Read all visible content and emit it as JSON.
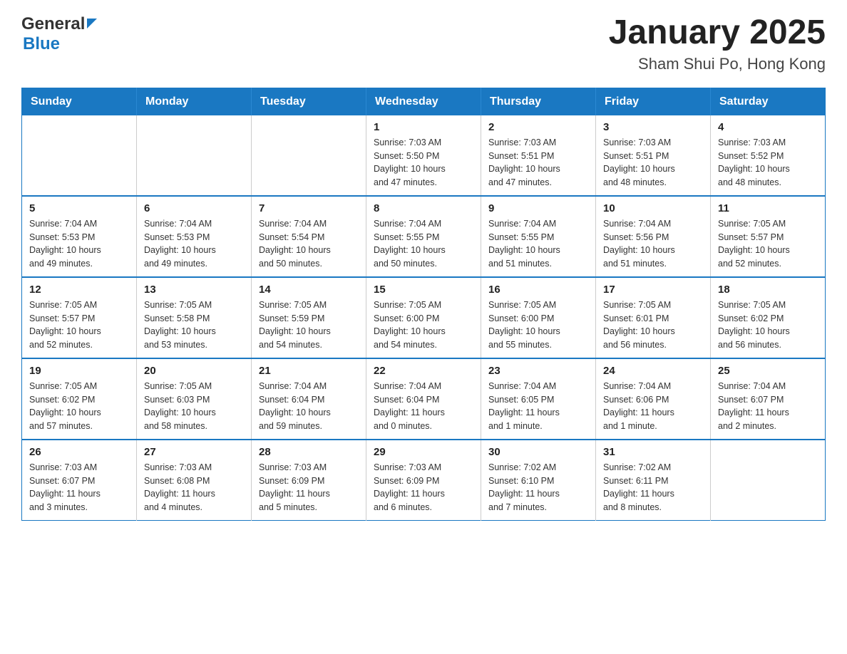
{
  "header": {
    "logo_general": "General",
    "logo_blue": "Blue",
    "title": "January 2025",
    "subtitle": "Sham Shui Po, Hong Kong"
  },
  "days_of_week": [
    "Sunday",
    "Monday",
    "Tuesday",
    "Wednesday",
    "Thursday",
    "Friday",
    "Saturday"
  ],
  "weeks": [
    [
      {
        "day": "",
        "info": ""
      },
      {
        "day": "",
        "info": ""
      },
      {
        "day": "",
        "info": ""
      },
      {
        "day": "1",
        "info": "Sunrise: 7:03 AM\nSunset: 5:50 PM\nDaylight: 10 hours\nand 47 minutes."
      },
      {
        "day": "2",
        "info": "Sunrise: 7:03 AM\nSunset: 5:51 PM\nDaylight: 10 hours\nand 47 minutes."
      },
      {
        "day": "3",
        "info": "Sunrise: 7:03 AM\nSunset: 5:51 PM\nDaylight: 10 hours\nand 48 minutes."
      },
      {
        "day": "4",
        "info": "Sunrise: 7:03 AM\nSunset: 5:52 PM\nDaylight: 10 hours\nand 48 minutes."
      }
    ],
    [
      {
        "day": "5",
        "info": "Sunrise: 7:04 AM\nSunset: 5:53 PM\nDaylight: 10 hours\nand 49 minutes."
      },
      {
        "day": "6",
        "info": "Sunrise: 7:04 AM\nSunset: 5:53 PM\nDaylight: 10 hours\nand 49 minutes."
      },
      {
        "day": "7",
        "info": "Sunrise: 7:04 AM\nSunset: 5:54 PM\nDaylight: 10 hours\nand 50 minutes."
      },
      {
        "day": "8",
        "info": "Sunrise: 7:04 AM\nSunset: 5:55 PM\nDaylight: 10 hours\nand 50 minutes."
      },
      {
        "day": "9",
        "info": "Sunrise: 7:04 AM\nSunset: 5:55 PM\nDaylight: 10 hours\nand 51 minutes."
      },
      {
        "day": "10",
        "info": "Sunrise: 7:04 AM\nSunset: 5:56 PM\nDaylight: 10 hours\nand 51 minutes."
      },
      {
        "day": "11",
        "info": "Sunrise: 7:05 AM\nSunset: 5:57 PM\nDaylight: 10 hours\nand 52 minutes."
      }
    ],
    [
      {
        "day": "12",
        "info": "Sunrise: 7:05 AM\nSunset: 5:57 PM\nDaylight: 10 hours\nand 52 minutes."
      },
      {
        "day": "13",
        "info": "Sunrise: 7:05 AM\nSunset: 5:58 PM\nDaylight: 10 hours\nand 53 minutes."
      },
      {
        "day": "14",
        "info": "Sunrise: 7:05 AM\nSunset: 5:59 PM\nDaylight: 10 hours\nand 54 minutes."
      },
      {
        "day": "15",
        "info": "Sunrise: 7:05 AM\nSunset: 6:00 PM\nDaylight: 10 hours\nand 54 minutes."
      },
      {
        "day": "16",
        "info": "Sunrise: 7:05 AM\nSunset: 6:00 PM\nDaylight: 10 hours\nand 55 minutes."
      },
      {
        "day": "17",
        "info": "Sunrise: 7:05 AM\nSunset: 6:01 PM\nDaylight: 10 hours\nand 56 minutes."
      },
      {
        "day": "18",
        "info": "Sunrise: 7:05 AM\nSunset: 6:02 PM\nDaylight: 10 hours\nand 56 minutes."
      }
    ],
    [
      {
        "day": "19",
        "info": "Sunrise: 7:05 AM\nSunset: 6:02 PM\nDaylight: 10 hours\nand 57 minutes."
      },
      {
        "day": "20",
        "info": "Sunrise: 7:05 AM\nSunset: 6:03 PM\nDaylight: 10 hours\nand 58 minutes."
      },
      {
        "day": "21",
        "info": "Sunrise: 7:04 AM\nSunset: 6:04 PM\nDaylight: 10 hours\nand 59 minutes."
      },
      {
        "day": "22",
        "info": "Sunrise: 7:04 AM\nSunset: 6:04 PM\nDaylight: 11 hours\nand 0 minutes."
      },
      {
        "day": "23",
        "info": "Sunrise: 7:04 AM\nSunset: 6:05 PM\nDaylight: 11 hours\nand 1 minute."
      },
      {
        "day": "24",
        "info": "Sunrise: 7:04 AM\nSunset: 6:06 PM\nDaylight: 11 hours\nand 1 minute."
      },
      {
        "day": "25",
        "info": "Sunrise: 7:04 AM\nSunset: 6:07 PM\nDaylight: 11 hours\nand 2 minutes."
      }
    ],
    [
      {
        "day": "26",
        "info": "Sunrise: 7:03 AM\nSunset: 6:07 PM\nDaylight: 11 hours\nand 3 minutes."
      },
      {
        "day": "27",
        "info": "Sunrise: 7:03 AM\nSunset: 6:08 PM\nDaylight: 11 hours\nand 4 minutes."
      },
      {
        "day": "28",
        "info": "Sunrise: 7:03 AM\nSunset: 6:09 PM\nDaylight: 11 hours\nand 5 minutes."
      },
      {
        "day": "29",
        "info": "Sunrise: 7:03 AM\nSunset: 6:09 PM\nDaylight: 11 hours\nand 6 minutes."
      },
      {
        "day": "30",
        "info": "Sunrise: 7:02 AM\nSunset: 6:10 PM\nDaylight: 11 hours\nand 7 minutes."
      },
      {
        "day": "31",
        "info": "Sunrise: 7:02 AM\nSunset: 6:11 PM\nDaylight: 11 hours\nand 8 minutes."
      },
      {
        "day": "",
        "info": ""
      }
    ]
  ]
}
